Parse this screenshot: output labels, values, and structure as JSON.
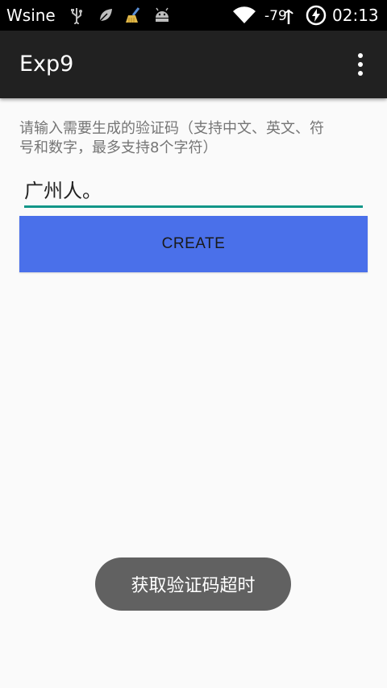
{
  "status_bar": {
    "carrier": "Wsine",
    "signal_strength": "-79",
    "time": "02:13",
    "icons": [
      "usb-icon",
      "leaf-icon",
      "broom-cleaner-icon",
      "android-icon",
      "wifi-icon",
      "signal-icon",
      "power-saver-icon"
    ]
  },
  "app_bar": {
    "title": "Exp9",
    "overflow_icon": "more-vert-icon"
  },
  "main": {
    "hint": "请输入需要生成的验证码（支持中文、英文、符号和数字，最多支持8个字符）",
    "input_value": "广州人。",
    "create_label": "CREATE"
  },
  "toast": {
    "message": "获取验证码超时"
  },
  "colors": {
    "status_bar": "#000000",
    "app_bar": "#212121",
    "accent_underline": "#129688",
    "button": "#4a70ea",
    "toast": "#616161",
    "background": "#fafafa"
  }
}
